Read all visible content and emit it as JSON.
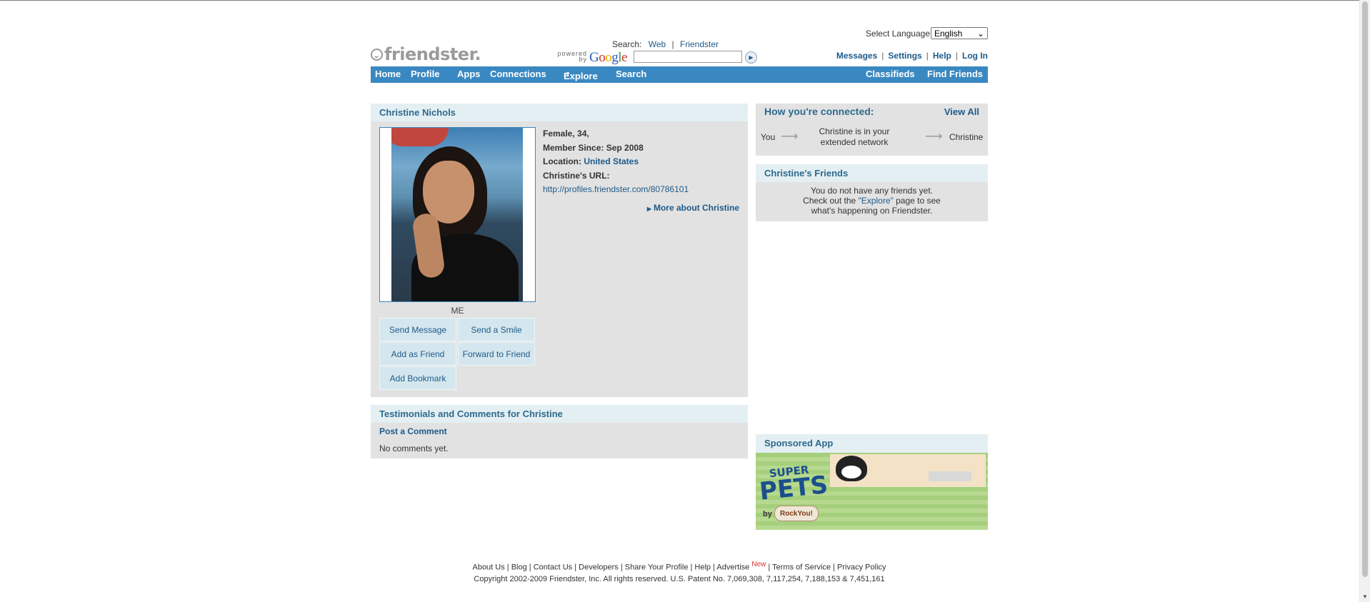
{
  "header": {
    "language_label": "Select Language",
    "language_value": "English",
    "logo_text": "friendster.",
    "search_label": "Search:",
    "search_web": "Web",
    "search_friendster": "Friendster",
    "powered_by": "powered by",
    "google": "Google",
    "search_value": "",
    "top_links": [
      "Messages",
      "Settings",
      "Help",
      "Log In"
    ]
  },
  "nav": {
    "home": "Home",
    "profile": "Profile",
    "apps": "Apps",
    "connections": "Connections",
    "explore": "Explore",
    "search": "Search",
    "classifieds": "Classifieds",
    "find_friends": "Find Friends"
  },
  "profile": {
    "name": "Christine Nichols",
    "photo_label": "ME",
    "gender_age": "Female, 34,",
    "member_since_label": "Member Since:",
    "member_since": "Sep 2008",
    "location_label": "Location:",
    "location": "United States",
    "url_label": "Christine's URL:",
    "url": "http://profiles.friendster.com/80786101",
    "more_about": "More about Christine",
    "actions": {
      "send_message": "Send Message",
      "send_smile": "Send a Smile",
      "add_friend": "Add as Friend",
      "forward": "Forward to Friend",
      "bookmark": "Add Bookmark"
    }
  },
  "testimonials": {
    "title": "Testimonials and Comments for Christine",
    "post_comment": "Post a Comment",
    "no_comments": "No comments yet."
  },
  "connected": {
    "title": "How you're connected:",
    "view_all": "View All",
    "you": "You",
    "arrow": "⟶",
    "middle": "Christine is in your extended network",
    "target": "Christine"
  },
  "friends": {
    "title": "Christine's Friends",
    "line1": "You do not have any friends yet.",
    "line2_prefix": "Check out the ",
    "line2_link": "\"Explore\"",
    "line2_suffix": " page to see",
    "line3": "what's happening on Friendster."
  },
  "sponsored": {
    "title": "Sponsored App",
    "app_name_1": "SUPER",
    "app_name_2": "PETS",
    "by": "by",
    "maker": "RockYou!"
  },
  "footer": {
    "links": [
      "About Us",
      "Blog",
      "Contact Us",
      "Developers",
      "Share Your Profile",
      "Help",
      "Advertise",
      "Terms of Service",
      "Privacy Policy"
    ],
    "new_badge": "New",
    "copyright": "Copyright 2002-2009 Friendster, Inc. All rights reserved. U.S. Patent No. 7,069,308, 7,117,254, 7,188,153 & 7,451,161"
  },
  "colors": {
    "nav_blue": "#3a88c1",
    "link_blue": "#1d5a8a",
    "panel_gray": "#e2e2e2",
    "panel_head": "#e4eff3"
  }
}
